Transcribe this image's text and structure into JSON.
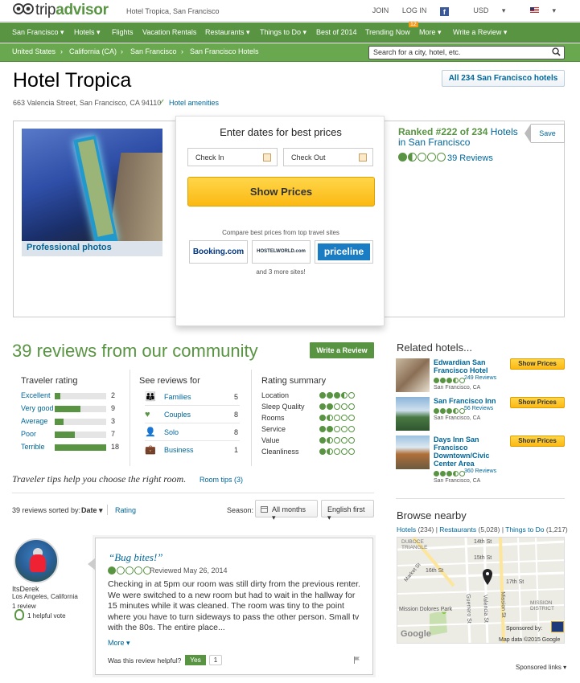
{
  "header": {
    "logo_prefix": "trip",
    "logo_suffix": "advisor",
    "crumb": "Hotel Tropica, San Francisco",
    "links": [
      "JOIN",
      "LOG IN"
    ],
    "facebook_glyph": "f",
    "currency": "USD",
    "currency_arrow": "▾",
    "flag_arrow": "▾"
  },
  "nav": {
    "items": [
      "San Francisco ▾",
      "Hotels ▾",
      "Flights",
      "Vacation Rentals",
      "Restaurants ▾",
      "Things to Do ▾",
      "Best of 2014",
      "Trending Now",
      "More ▾",
      "Write a Review ▾"
    ],
    "trending_badge": "12"
  },
  "subnav": {
    "crumbs": [
      "United States",
      "›",
      "California (CA)",
      "›",
      "San Francisco",
      "›",
      "San Francisco Hotels"
    ],
    "search_placeholder": "Search for a city, hotel, etc."
  },
  "hotel": {
    "name": "Hotel Tropica",
    "address": "663 Valencia Street, San Francisco, CA 94110",
    "check_glyph": "✓",
    "amenities_link": "Hotel amenities",
    "all_hotels_button": "All 234 San Francisco hotels",
    "photo_label": "Professional photos"
  },
  "pricing": {
    "title": "Enter dates for best prices",
    "check_in": "Check In",
    "check_out": "Check Out",
    "show_prices": "Show Prices",
    "compare": "Compare best prices from top travel sites",
    "partners": [
      "Booking.com",
      "HOSTELWORLD.com",
      "priceline"
    ],
    "more_sites": "and 3 more sites!"
  },
  "ranking": {
    "ranked_bold": "Ranked #222 of 234",
    "ranked_rest": " Hotels in San Francisco",
    "save": "Save",
    "rating": 1.5,
    "reviews": "39 Reviews"
  },
  "reviews_section": {
    "title": "39 reviews from our community",
    "write_review": "Write a Review",
    "traveler_rating_title": "Traveler rating",
    "traveler_rating": [
      {
        "label": "Excellent",
        "count": 2
      },
      {
        "label": "Very good",
        "count": 9
      },
      {
        "label": "Average",
        "count": 3
      },
      {
        "label": "Poor",
        "count": 7
      },
      {
        "label": "Terrible",
        "count": 18
      }
    ],
    "see_reviews_title": "See reviews for",
    "see_reviews": [
      {
        "icon": "family-icon",
        "glyph": "👪",
        "label": "Families",
        "count": 5
      },
      {
        "icon": "heart-icon",
        "glyph": "♥",
        "label": "Couples",
        "count": 8
      },
      {
        "icon": "person-icon",
        "glyph": "👤",
        "label": "Solo",
        "count": 8
      },
      {
        "icon": "briefcase-icon",
        "glyph": "💼",
        "label": "Business",
        "count": 1
      }
    ],
    "rating_summary_title": "Rating summary",
    "rating_summary": [
      {
        "label": "Location",
        "rating": 3.5
      },
      {
        "label": "Sleep Quality",
        "rating": 2
      },
      {
        "label": "Rooms",
        "rating": 1.5
      },
      {
        "label": "Service",
        "rating": 2
      },
      {
        "label": "Value",
        "rating": 1.5
      },
      {
        "label": "Cleanliness",
        "rating": 1.5
      }
    ],
    "tips": "Traveler tips help you choose the right room.",
    "room_tips": "Room tips (3)",
    "sorted_by": "39 reviews sorted by:",
    "sort_date": "Date ▾",
    "sort_rating": "Rating",
    "season_label": "Season:",
    "season_value": "All months  ▾",
    "language_value": "English first  ▾"
  },
  "review": {
    "user": "ItsDerek",
    "location": "Los Angeles, California",
    "user_reviews": "1 review",
    "helpful_votes": "1 helpful vote",
    "title": "“Bug bites!”",
    "rating": 1,
    "date": "Reviewed May 26, 2014",
    "text": "Checking in at 5pm our room was still dirty from the previous renter. We were switched to a new room but had to wait in the hallway for 15 minutes while it was cleaned. The room was tiny to the point where you have to turn sideways to pass the other person. Small tv with the 80s. The entire place...",
    "more": "More ▾",
    "helpful_q": "Was this review helpful?",
    "yes": "Yes",
    "yes_count": "1"
  },
  "related": {
    "title": "Related hotels...",
    "button": "Show Prices",
    "hotels": [
      {
        "name": "Edwardian San Francisco Hotel",
        "reviews": "249 Reviews",
        "location": "San Francisco, CA",
        "rating": 3.5
      },
      {
        "name": "San Francisco Inn",
        "reviews": "56 Reviews",
        "location": "San Francisco, CA",
        "rating": 3.5
      },
      {
        "name": "Days Inn San Francisco Downtown/Civic Center Area",
        "reviews": "360 Reviews",
        "location": "San Francisco, CA",
        "rating": 3.5
      }
    ]
  },
  "browse": {
    "title": "Browse nearby",
    "hotels": "Hotels",
    "hotels_count": "(234)",
    "restaurants": "Restaurants",
    "restaurants_count": "(5,028)",
    "things": "Things to Do",
    "things_count": "(1,217)",
    "separator": "|",
    "map_labels": [
      "DUBOCE TRIANGLE",
      "14th St",
      "15th St",
      "16th St",
      "Market St",
      "17th St",
      "Guerrero St",
      "Valencia St",
      "Mission St",
      "MISSION DISTRICT",
      "Mission Dolores Park",
      "Google",
      "Sponsored by:"
    ],
    "map_credit": "Map data ©2015 Google",
    "sponsored_links": "Sponsored links ▾"
  }
}
